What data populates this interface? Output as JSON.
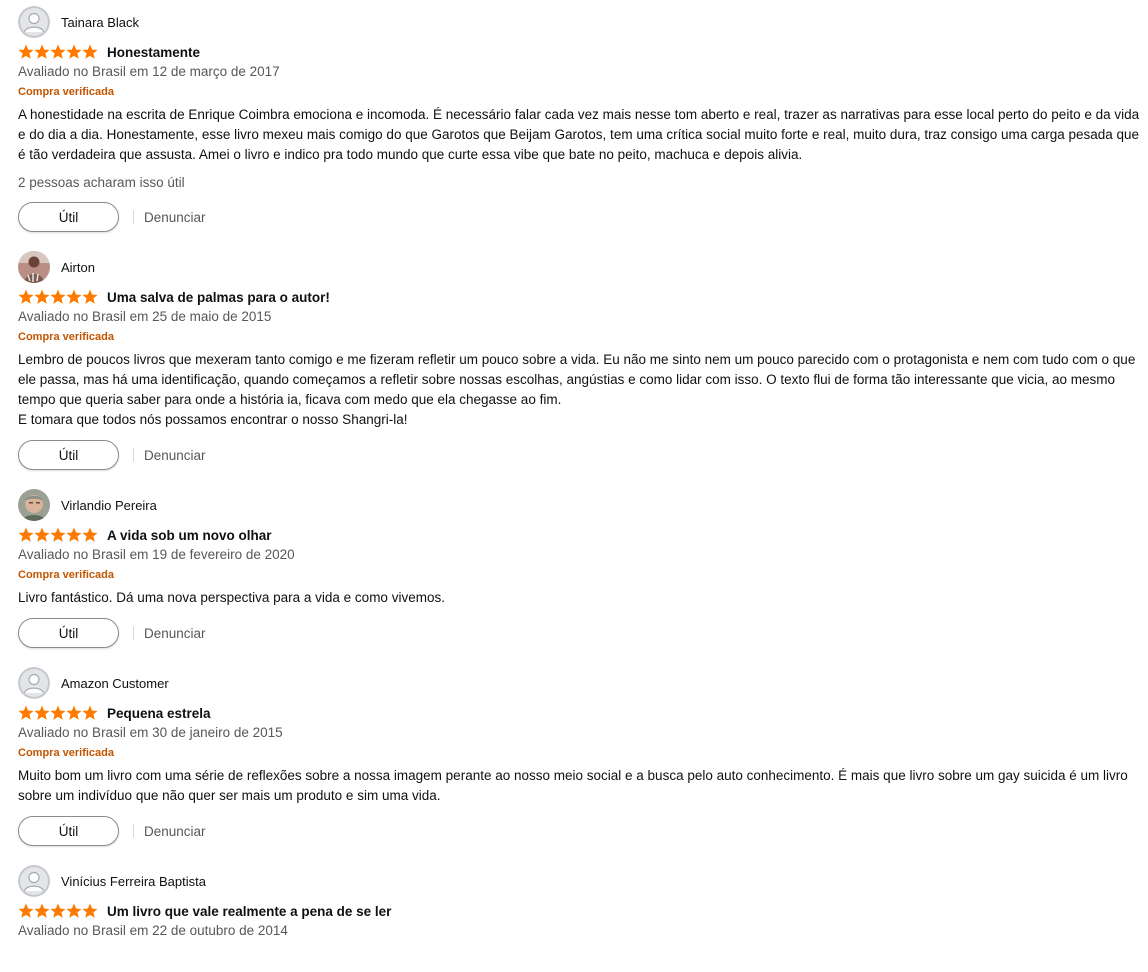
{
  "reviews": [
    {
      "author": "Tainara Black",
      "avatar": "default-avatar",
      "rating": 5,
      "title": "Honestamente",
      "meta": "Avaliado no Brasil em 12 de março de 2017",
      "verified": "Compra verificada",
      "body": "A honestidade na escrita de Enrique Coimbra emociona e incomoda. É necessário falar cada vez mais nesse tom aberto e real, trazer as narrativas para esse local perto do peito e da vida e do dia a dia. Honestamente, esse livro mexeu mais comigo do que Garotos que Beijam Garotos, tem uma crítica social muito forte e real, muito dura, traz consigo uma carga pesada que é tão verdadeira que assusta. Amei o livro e indico pra todo mundo que curte essa vibe que bate no peito, machuca e depois alivia.",
      "helpful": "2 pessoas acharam isso útil",
      "util_label": "Útil",
      "report_label": "Denunciar"
    },
    {
      "author": "Airton",
      "avatar": "photo-avatar",
      "rating": 5,
      "title": "Uma salva de palmas para o autor!",
      "meta": "Avaliado no Brasil em 25 de maio de 2015",
      "verified": "Compra verificada",
      "body": "Lembro de poucos livros que mexeram tanto comigo e me fizeram refletir um pouco sobre a vida. Eu não me sinto nem um pouco parecido com o protagonista e nem com tudo com o que ele passa, mas há uma identificação, quando começamos a refletir sobre nossas escolhas, angústias e como lidar com isso. O texto flui de forma tão interessante que vicia, ao mesmo tempo que queria saber para onde a história ia, ficava com medo que ela chegasse ao fim.\nE tomara que todos nós possamos encontrar o nosso Shangri-la!",
      "helpful": "",
      "util_label": "Útil",
      "report_label": "Denunciar"
    },
    {
      "author": "Virlandio Pereira",
      "avatar": "photo-avatar",
      "rating": 5,
      "title": "A vida sob um novo olhar",
      "meta": "Avaliado no Brasil em 19 de fevereiro de 2020",
      "verified": "Compra verificada",
      "body": "Livro fantástico. Dá uma nova perspectiva para a vida e como vivemos.",
      "helpful": "",
      "util_label": "Útil",
      "report_label": "Denunciar"
    },
    {
      "author": "Amazon Customer",
      "avatar": "default-avatar",
      "rating": 5,
      "title": "Pequena estrela",
      "meta": "Avaliado no Brasil em 30 de janeiro de 2015",
      "verified": "Compra verificada",
      "body": "Muito bom um livro com uma série de reflexões sobre a nossa imagem perante ao nosso meio social e a busca pelo auto conhecimento. É mais que livro sobre um gay suicida é um livro sobre um indivíduo que não quer ser mais um produto e sim uma vida.",
      "helpful": "",
      "util_label": "Útil",
      "report_label": "Denunciar"
    },
    {
      "author": "Vinícius Ferreira Baptista",
      "avatar": "default-avatar",
      "rating": 5,
      "title": "Um livro que vale realmente a pena de se ler",
      "meta": "Avaliado no Brasil em 22 de outubro de 2014",
      "verified": "",
      "body": "",
      "helpful": "",
      "util_label": "",
      "report_label": ""
    }
  ],
  "colors": {
    "star": "#ff7a00",
    "verified": "#c45500",
    "muted": "#565959",
    "text": "#0f1111"
  }
}
